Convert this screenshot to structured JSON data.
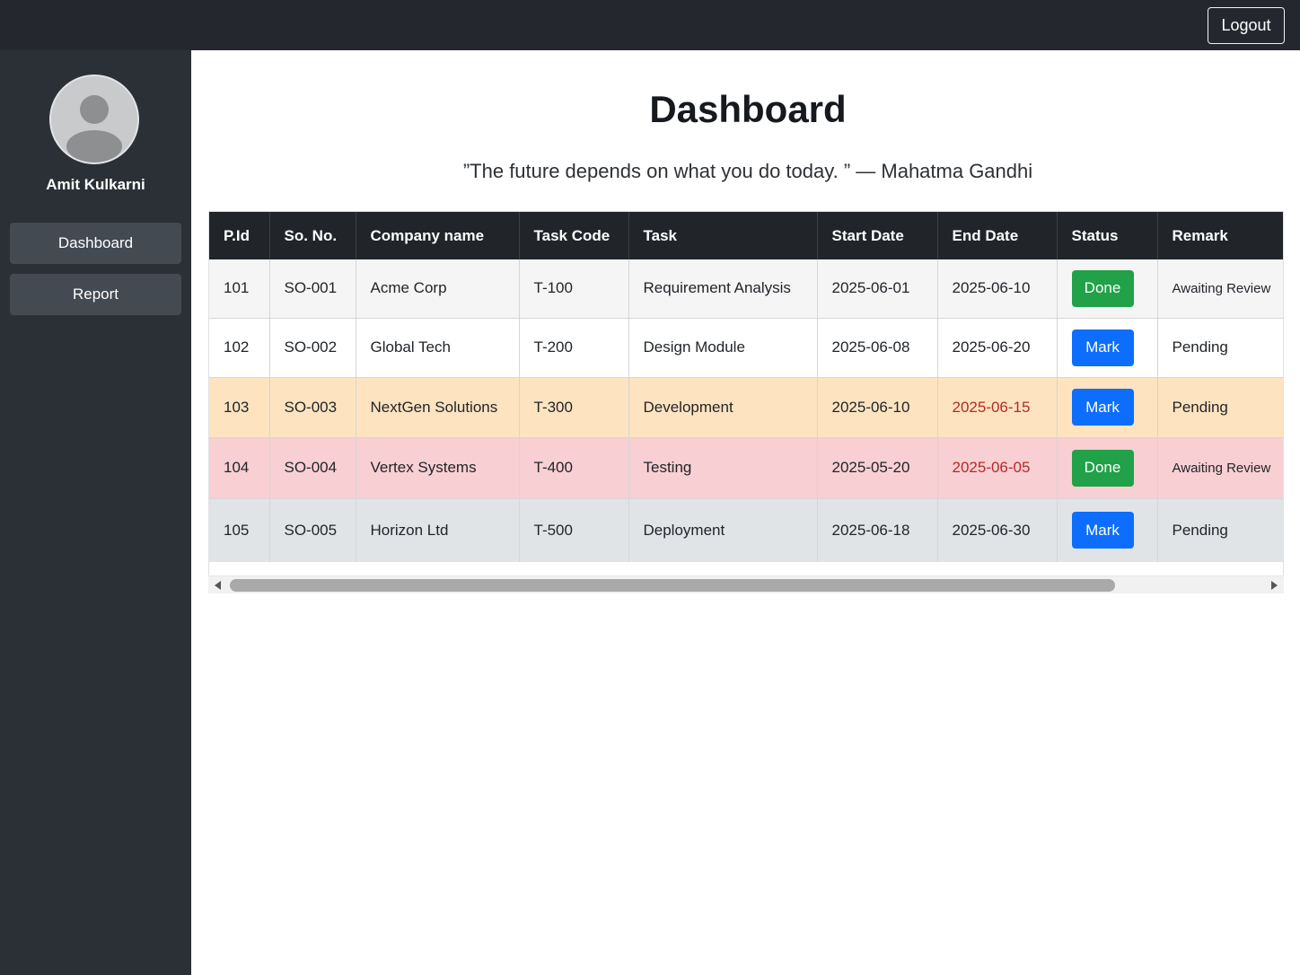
{
  "header": {
    "logout_label": "Logout"
  },
  "sidebar": {
    "user_name": "Amit Kulkarni",
    "items": [
      {
        "label": "Dashboard"
      },
      {
        "label": "Report"
      }
    ]
  },
  "main": {
    "title": "Dashboard",
    "quote": "”The future depends on what you do today. ” — Mahatma Gandhi"
  },
  "table": {
    "columns": [
      "P.Id",
      "So. No.",
      "Company name",
      "Task Code",
      "Task",
      "Start Date",
      "End Date",
      "Status",
      "Remark"
    ],
    "rows": [
      {
        "pid": "101",
        "so_no": "SO-001",
        "company": "Acme Corp",
        "task_code": "T-100",
        "task": "Requirement Analysis",
        "start_date": "2025-06-01",
        "end_date": "2025-06-10",
        "status": "Done",
        "remark": "Awaiting Review"
      },
      {
        "pid": "102",
        "so_no": "SO-002",
        "company": "Global Tech",
        "task_code": "T-200",
        "task": "Design Module",
        "start_date": "2025-06-08",
        "end_date": "2025-06-20",
        "status": "Mark",
        "remark": "Pending"
      },
      {
        "pid": "103",
        "so_no": "SO-003",
        "company": "NextGen Solutions",
        "task_code": "T-300",
        "task": "Development",
        "start_date": "2025-06-10",
        "end_date": "2025-06-15",
        "status": "Mark",
        "remark": "Pending"
      },
      {
        "pid": "104",
        "so_no": "SO-004",
        "company": "Vertex Systems",
        "task_code": "T-400",
        "task": "Testing",
        "start_date": "2025-05-20",
        "end_date": "2025-06-05",
        "status": "Done",
        "remark": "Awaiting Review"
      },
      {
        "pid": "105",
        "so_no": "SO-005",
        "company": "Horizon Ltd",
        "task_code": "T-500",
        "task": "Deployment",
        "start_date": "2025-06-18",
        "end_date": "2025-06-30",
        "status": "Mark",
        "remark": "Pending"
      }
    ]
  },
  "colors": {
    "topbar": "#24282e",
    "sidebar": "#2b3036",
    "done_button": "#21a148",
    "mark_button": "#0d6efd",
    "row_warning": "#fde3bf",
    "row_danger": "#f8cfd3",
    "row_secondary": "#e1e4e7",
    "overdue_text": "#b52a2a"
  }
}
